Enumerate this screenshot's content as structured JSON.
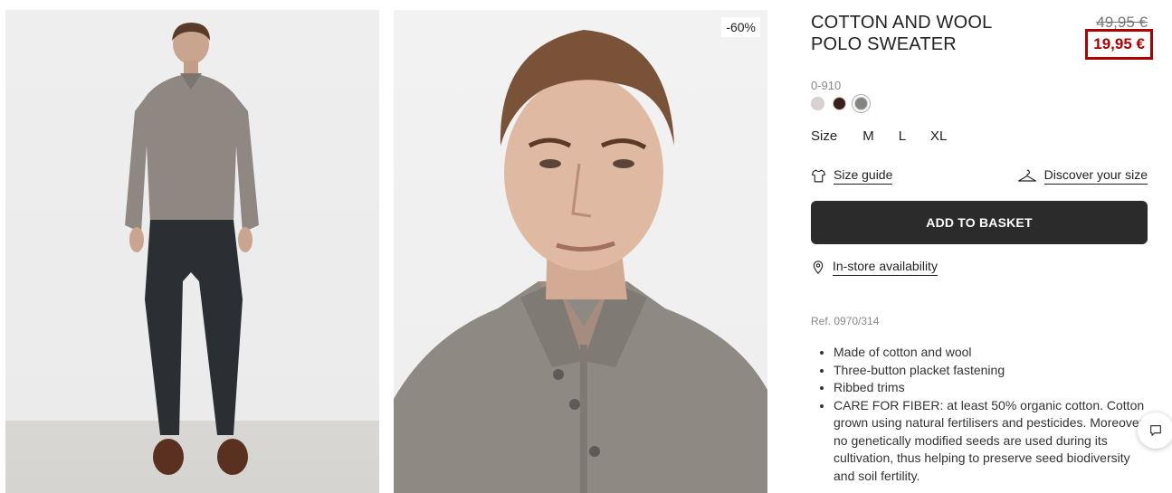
{
  "product": {
    "title": "COTTON AND WOOL POLO SWEATER",
    "price_old": "49,95 €",
    "price_new": "19,95 €",
    "discount_badge": "-60%",
    "color_code": "0-910",
    "swatches": [
      {
        "name": "light beige",
        "color": "#d9d2ce"
      },
      {
        "name": "dark brown",
        "color": "#3b1f1a"
      },
      {
        "name": "grey",
        "color": "#858480",
        "selected": true
      }
    ],
    "size_label": "Size",
    "sizes": [
      "M",
      "L",
      "XL"
    ],
    "size_guide_label": "Size guide",
    "discover_size_label": "Discover your size",
    "add_to_basket_label": "ADD TO BASKET",
    "in_store_label": "In-store availability",
    "reference": "Ref. 0970/314",
    "features": [
      "Made of cotton and wool",
      "Three-button placket fastening",
      "Ribbed trims",
      "CARE FOR FIBER: at least 50% organic cotton. Cotton grown using natural fertilisers and pesticides. Moreover, no genetically modified seeds are used during its cultivation, thus helping to preserve seed biodiversity and soil fertility."
    ]
  },
  "icons": {
    "size_guide": "t-shirt-icon",
    "discover_size": "hanger-icon",
    "in_store": "location-pin-icon",
    "chat": "chat-bubble-icon"
  }
}
